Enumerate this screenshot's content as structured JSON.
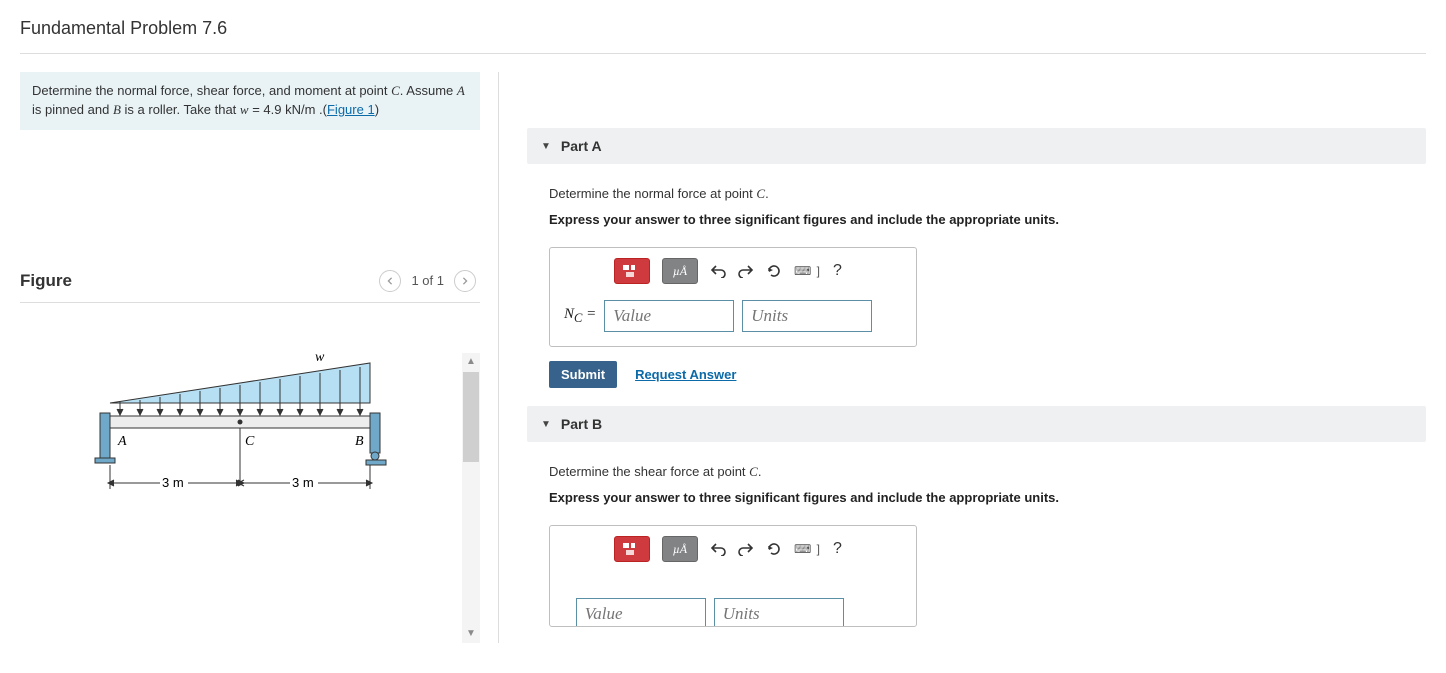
{
  "title": "Fundamental Problem 7.6",
  "prompt": {
    "t1": "Determine the normal force, shear force, and moment at point ",
    "C": "C",
    "t2": ". Assume ",
    "A": "A",
    "t3": " is pinned and ",
    "B": "B",
    "t4": " is a roller. Take that ",
    "w": "w",
    "t5": " = 4.9 ",
    "unit": "kN/m",
    "t6": " .(",
    "link": "Figure 1",
    "t7": ")"
  },
  "figure": {
    "heading": "Figure",
    "counter": "1 of 1",
    "labels": {
      "w": "w",
      "A": "A",
      "B": "B",
      "C": "C",
      "d1": "3 m",
      "d2": "3 m"
    }
  },
  "partA": {
    "header": "Part A",
    "q": "Determine the normal force at point ",
    "Cpoint": "C",
    "qend": ".",
    "bold": "Express your answer to three significant figures and include the appropriate units.",
    "ua_label": "µÅ",
    "kbd": "⌨ ]",
    "var": "N",
    "sub": "C",
    "eq": " =",
    "value_ph": "Value",
    "units_ph": "Units",
    "submit": "Submit",
    "request": "Request Answer"
  },
  "partB": {
    "header": "Part B",
    "q": "Determine the shear force at point ",
    "Cpoint": "C",
    "qend": ".",
    "bold": "Express your answer to three significant figures and include the appropriate units.",
    "ua_label": "µÅ",
    "kbd": "⌨ ]",
    "value_ph": "Value",
    "units_ph": "Units"
  }
}
